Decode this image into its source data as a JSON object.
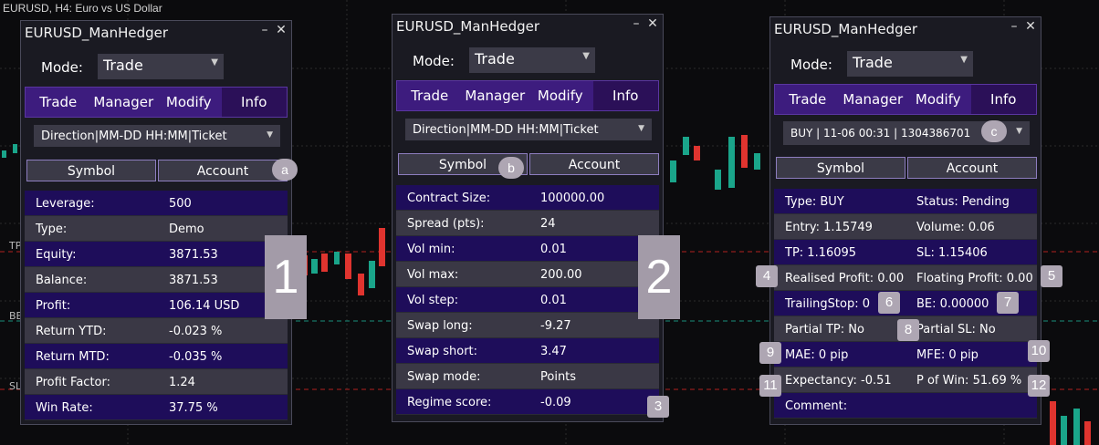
{
  "chart": {
    "title": "EURUSD, H4:  Euro vs US Dollar"
  },
  "axis_labels": {
    "tp": "TP",
    "be": "BE",
    "sl": "SL"
  },
  "panels": [
    {
      "title": "EURUSD_ManHedger",
      "mode_label": "Mode:",
      "mode_value": "Trade",
      "tabs": [
        "Trade",
        "Manager",
        "Modify",
        "Info"
      ],
      "active_tab": "Info",
      "dropdown": "Direction|MM-DD HH:MM|Ticket",
      "buttons": [
        "Symbol",
        "Account"
      ],
      "rows": [
        {
          "k": "Leverage:",
          "v": "500"
        },
        {
          "k": "Type:",
          "v": "Demo"
        },
        {
          "k": "Equity:",
          "v": "3871.53"
        },
        {
          "k": "Balance:",
          "v": "3871.53"
        },
        {
          "k": "Profit:",
          "v": "106.14 USD"
        },
        {
          "k": "Return YTD:",
          "v": "-0.023 %"
        },
        {
          "k": "Return MTD:",
          "v": "-0.035 %"
        },
        {
          "k": "Profit Factor:",
          "v": "1.24"
        },
        {
          "k": "Win Rate:",
          "v": "37.75 %"
        }
      ]
    },
    {
      "title": "EURUSD_ManHedger",
      "mode_label": "Mode:",
      "mode_value": "Trade",
      "tabs": [
        "Trade",
        "Manager",
        "Modify",
        "Info"
      ],
      "active_tab": "Info",
      "dropdown": "Direction|MM-DD HH:MM|Ticket",
      "buttons": [
        "Symbol",
        "Account"
      ],
      "rows": [
        {
          "k": "Contract Size:",
          "v": "100000.00"
        },
        {
          "k": "Spread (pts):",
          "v": "24"
        },
        {
          "k": "Vol min:",
          "v": "0.01"
        },
        {
          "k": "Vol max:",
          "v": "200.00"
        },
        {
          "k": "Vol step:",
          "v": "0.01"
        },
        {
          "k": "Swap long:",
          "v": "-9.27"
        },
        {
          "k": "Swap short:",
          "v": "3.47"
        },
        {
          "k": "Swap mode:",
          "v": "Points"
        },
        {
          "k": "Regime score:",
          "v": "-0.09"
        }
      ]
    },
    {
      "title": "EURUSD_ManHedger",
      "mode_label": "Mode:",
      "mode_value": "Trade",
      "tabs": [
        "Trade",
        "Manager",
        "Modify",
        "Info"
      ],
      "active_tab": "Info",
      "dropdown": "BUY | 11-06 00:31  | 1304386701",
      "buttons": [
        "Symbol",
        "Account"
      ],
      "rows": [
        {
          "a": "Type: BUY",
          "b": "Status: Pending"
        },
        {
          "a": "Entry: 1.15749",
          "b": "Volume: 0.06"
        },
        {
          "a": "TP: 1.16095",
          "b": "SL: 1.15406"
        },
        {
          "a": "Realised Profit: 0.00",
          "b": "Floating Profit: 0.00"
        },
        {
          "a": "TrailingStop: 0",
          "b": "BE: 0.00000"
        },
        {
          "a": "Partial TP: No",
          "b": "Partial SL: No"
        },
        {
          "a": "MAE: 0 pip",
          "b": "MFE: 0 pip"
        },
        {
          "a": "Expectancy: -0.51",
          "b": "P of Win: 51.69 %"
        },
        {
          "a": "Comment:",
          "b": ""
        }
      ]
    }
  ],
  "badges": {
    "a": "a",
    "b": "b",
    "c": "c",
    "n1": "1",
    "n2": "2",
    "n3": "3",
    "n4": "4",
    "n5": "5",
    "n6": "6",
    "n7": "7",
    "n8": "8",
    "n9": "9",
    "n10": "10",
    "n11": "11",
    "n12": "12"
  },
  "colors": {
    "accent": "#3d1c7e",
    "bull": "#1aa58a",
    "bear": "#e0342f",
    "badge": "#aea6b3"
  }
}
